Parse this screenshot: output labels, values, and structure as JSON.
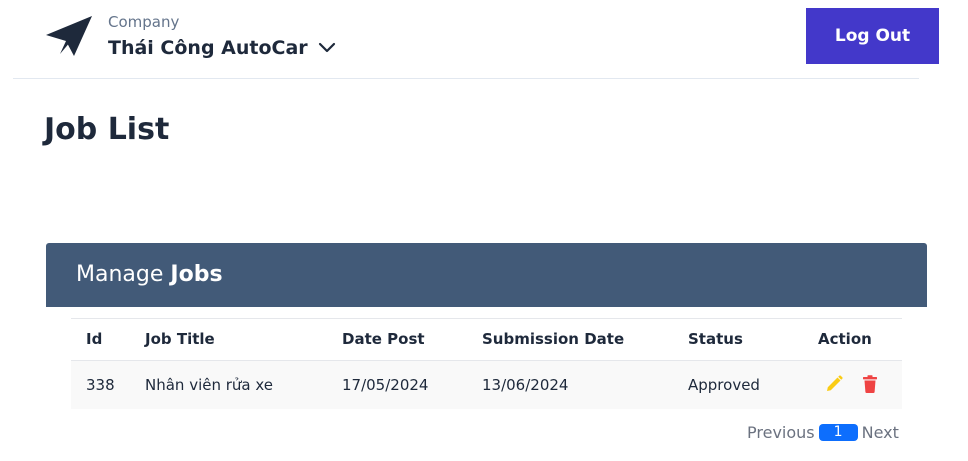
{
  "header": {
    "company_label": "Company",
    "company_name": "Thái Công AutoCar",
    "logout_label": "Log Out",
    "logo_icon": "paper-plane-icon",
    "dropdown_icon": "chevron-down-icon"
  },
  "page": {
    "title": "Job List"
  },
  "panel": {
    "title_prefix": "Manage ",
    "title_bold": "Jobs"
  },
  "table": {
    "headers": {
      "id": "Id",
      "title": "Job Title",
      "date_post": "Date Post",
      "submission": "Submission Date",
      "status": "Status",
      "action": "Action"
    },
    "rows": [
      {
        "id": "338",
        "title": "Nhân viên rửa xe",
        "date_post": "17/05/2024",
        "submission": "13/06/2024",
        "status": "Approved"
      }
    ],
    "action_icons": [
      "pencil-icon",
      "trash-icon"
    ]
  },
  "pagination": {
    "previous": "Previous",
    "page": "1",
    "next": "Next"
  },
  "colors": {
    "accent": "#4338ca",
    "panel": "#425a78",
    "edit": "#facc15",
    "delete": "#ef4444",
    "page_active": "#0d6efd"
  }
}
